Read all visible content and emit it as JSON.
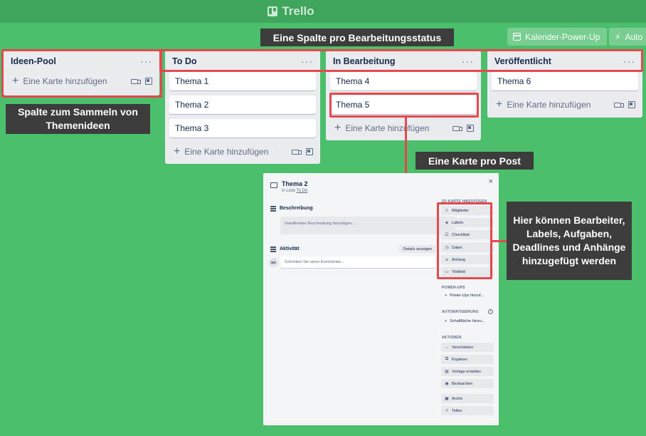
{
  "app": {
    "title": "Trello"
  },
  "powerups": {
    "calendar": "Kalender-Power-Up",
    "auto": "Auto"
  },
  "callouts": {
    "top": "Eine Spalte pro Bearbeitungsstatus",
    "left": "Spalte zum Sammeln von Themenideen",
    "mid": "Eine Karte pro Post",
    "right": "Hier können Bearbeiter, Labels, Aufgaben, Deadlines und Anhänge hinzugefügt werden"
  },
  "lists": [
    {
      "title": "Ideen-Pool",
      "cards": [],
      "add_label": "Eine Karte hinzufügen"
    },
    {
      "title": "To Do",
      "cards": [
        "Thema 1",
        "Thema 2",
        "Thema 3"
      ],
      "add_label": "Eine Karte hinzufügen"
    },
    {
      "title": "In Bearbeitung",
      "cards": [
        "Thema 4",
        "Thema 5"
      ],
      "add_label": "Eine Karte hinzufügen"
    },
    {
      "title": "Veröffentlicht",
      "cards": [
        "Thema 6"
      ],
      "add_label": "Eine Karte hinzufügen"
    }
  ],
  "modal": {
    "title": "Thema 2",
    "in_list_prefix": "in Liste",
    "in_list_name": "To Do",
    "close": "×",
    "description_title": "Beschreibung",
    "description_placeholder": "Detailliertere Beschreibung hinzufügen ...",
    "activity_title": "Aktivität",
    "details_button": "Details anzeigen",
    "avatar_initials": "EG",
    "comment_placeholder": "Schreiben Sie einen Kommentar...",
    "add_to_card_label": "ZU KARTE HINZUFÜGEN",
    "add_to_card": [
      "Mitglieder",
      "Labels",
      "Checkliste",
      "Daten",
      "Anhang",
      "Titelbild"
    ],
    "powerups_label": "POWER-UPS",
    "powerups_add": "Power-Ups hinzuf...",
    "automation_label": "AUTOMATISIERUNG",
    "automation_add": "Schaltfläche hinzu...",
    "actions_label": "AKTIONEN",
    "actions": [
      "Verschieben",
      "Kopieren",
      "Vorlage erstellen",
      "Beobachten",
      "Archiv",
      "Teilen"
    ]
  },
  "colors": {
    "board_bg": "#4bbf6b",
    "header_bg": "#3fa55c",
    "highlight": "#e5484d",
    "callout_bg": "#3c3c3c"
  }
}
